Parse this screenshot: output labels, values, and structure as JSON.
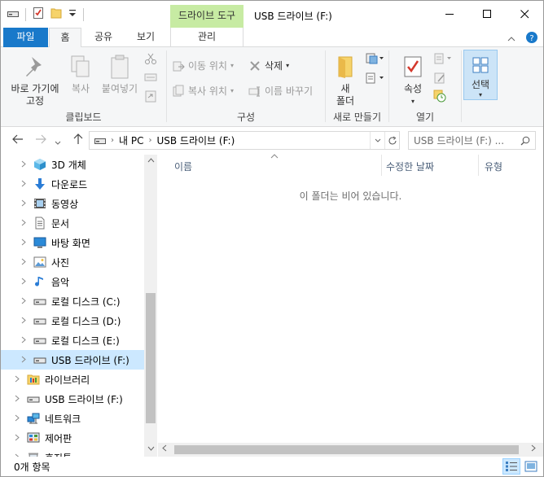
{
  "titlebar": {
    "tool_tab_title": "드라이브 도구",
    "window_title": "USB 드라이브 (F:)",
    "minimize": "—",
    "maximize": "☐",
    "close": "✕"
  },
  "ribbon_tabs": {
    "file": "파일",
    "home": "홈",
    "share": "공유",
    "view": "보기",
    "manage": "관리"
  },
  "ribbon": {
    "clipboard": {
      "pin_label_1": "바로 가기에",
      "pin_label_2": "고정",
      "copy": "복사",
      "paste": "붙여넣기",
      "group_label": "클립보드"
    },
    "organize": {
      "move_to": "이동 위치",
      "copy_to": "복사 위치",
      "delete": "삭제",
      "rename": "이름 바꾸기",
      "group_label": "구성"
    },
    "new": {
      "new_folder_1": "새",
      "new_folder_2": "폴더",
      "group_label": "새로 만들기"
    },
    "open": {
      "properties": "속성",
      "group_label": "열기"
    },
    "select": {
      "label": "선택"
    }
  },
  "address": {
    "crumb_pc": "내 PC",
    "crumb_drive": "USB 드라이브 (F:)",
    "search_placeholder": "USB 드라이브 (F:) ..."
  },
  "nav_tree": [
    {
      "label": "3D 개체",
      "icon": "3d-objects-icon",
      "selected": false
    },
    {
      "label": "다운로드",
      "icon": "download-icon",
      "selected": false
    },
    {
      "label": "동영상",
      "icon": "video-icon",
      "selected": false
    },
    {
      "label": "문서",
      "icon": "document-icon",
      "selected": false
    },
    {
      "label": "바탕 화면",
      "icon": "desktop-icon",
      "selected": false
    },
    {
      "label": "사진",
      "icon": "pictures-icon",
      "selected": false
    },
    {
      "label": "음악",
      "icon": "music-icon",
      "selected": false
    },
    {
      "label": "로컬 디스크 (C:)",
      "icon": "drive-icon",
      "selected": false
    },
    {
      "label": "로컬 디스크 (D:)",
      "icon": "drive-icon",
      "selected": false
    },
    {
      "label": "로컬 디스크 (E:)",
      "icon": "drive-icon",
      "selected": false
    },
    {
      "label": "USB 드라이브 (F:)",
      "icon": "usb-drive-icon",
      "selected": true
    },
    {
      "label": "라이브러리",
      "icon": "library-icon",
      "selected": false
    },
    {
      "label": "USB 드라이브 (F:)",
      "icon": "usb-drive-icon",
      "selected": false
    },
    {
      "label": "네트워크",
      "icon": "network-icon",
      "selected": false
    },
    {
      "label": "제어판",
      "icon": "control-panel-icon",
      "selected": false
    },
    {
      "label": "휴지통",
      "icon": "recycle-bin-icon",
      "selected": false
    }
  ],
  "columns": {
    "name": "이름",
    "modified": "수정한 날짜",
    "type": "유형"
  },
  "content": {
    "empty_message": "이 폴더는 비어 있습니다."
  },
  "status": {
    "item_count": "0개 항목"
  }
}
